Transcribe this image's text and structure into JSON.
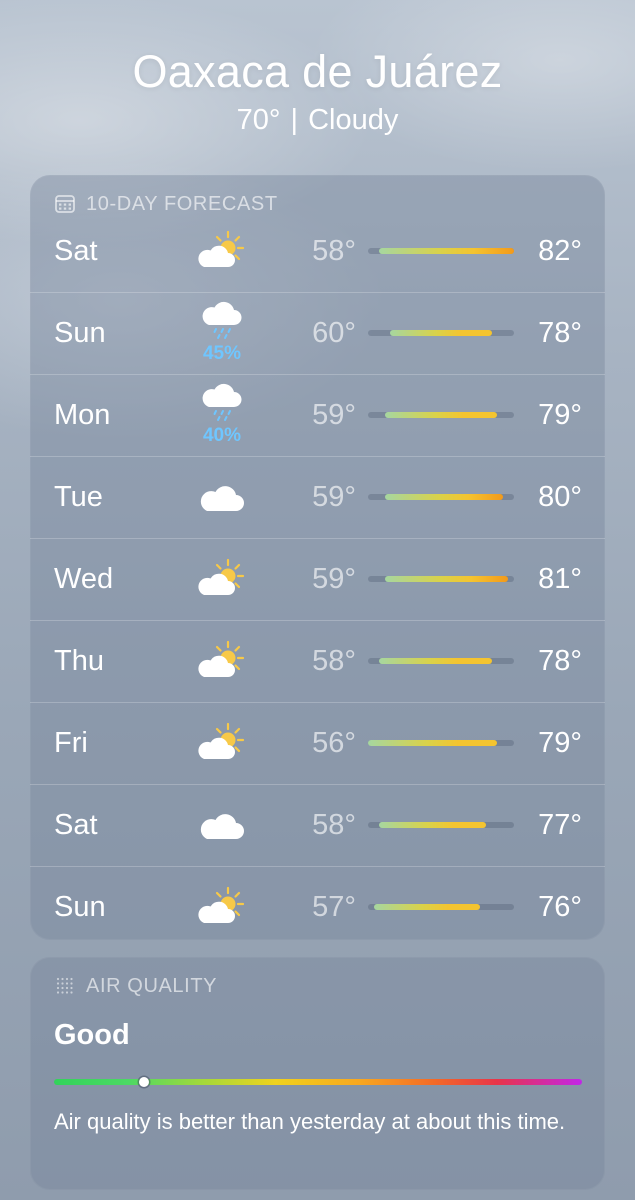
{
  "location": {
    "city": "Oaxaca de Juárez",
    "temperature": "70°",
    "separator": "|",
    "condition": "Cloudy"
  },
  "forecast": {
    "header": "10-DAY FORECAST",
    "header_icon": "calendar-icon",
    "range_min": 56,
    "range_max": 82,
    "days": [
      {
        "day": "Sat",
        "icon": "partly-sunny-icon",
        "precip": "",
        "low": "58°",
        "high": "82°",
        "low_value": 58,
        "high_value": 82
      },
      {
        "day": "Sun",
        "icon": "rain-cloud-icon",
        "precip": "45%",
        "low": "60°",
        "high": "78°",
        "low_value": 60,
        "high_value": 78
      },
      {
        "day": "Mon",
        "icon": "rain-cloud-icon",
        "precip": "40%",
        "low": "59°",
        "high": "79°",
        "low_value": 59,
        "high_value": 79
      },
      {
        "day": "Tue",
        "icon": "cloud-icon",
        "precip": "",
        "low": "59°",
        "high": "80°",
        "low_value": 59,
        "high_value": 80
      },
      {
        "day": "Wed",
        "icon": "partly-sunny-icon",
        "precip": "",
        "low": "59°",
        "high": "81°",
        "low_value": 59,
        "high_value": 81
      },
      {
        "day": "Thu",
        "icon": "partly-sunny-icon",
        "precip": "",
        "low": "58°",
        "high": "78°",
        "low_value": 58,
        "high_value": 78
      },
      {
        "day": "Fri",
        "icon": "partly-sunny-icon",
        "precip": "",
        "low": "56°",
        "high": "79°",
        "low_value": 56,
        "high_value": 79
      },
      {
        "day": "Sat",
        "icon": "cloud-icon",
        "precip": "",
        "low": "58°",
        "high": "77°",
        "low_value": 58,
        "high_value": 77
      },
      {
        "day": "Sun",
        "icon": "partly-sunny-icon",
        "precip": "",
        "low": "57°",
        "high": "76°",
        "low_value": 57,
        "high_value": 76
      }
    ]
  },
  "air_quality": {
    "header": "AIR QUALITY",
    "header_icon": "air-quality-icon",
    "value": "Good",
    "level_fraction": 0.17,
    "description": "Air quality is better than yesterday at about this time."
  },
  "colors": {
    "precip": "#6fc6ff",
    "sun": "#f7c948",
    "cool": "#a6d6a0",
    "warm": "#f4c430",
    "hot": "#f39a1a"
  }
}
